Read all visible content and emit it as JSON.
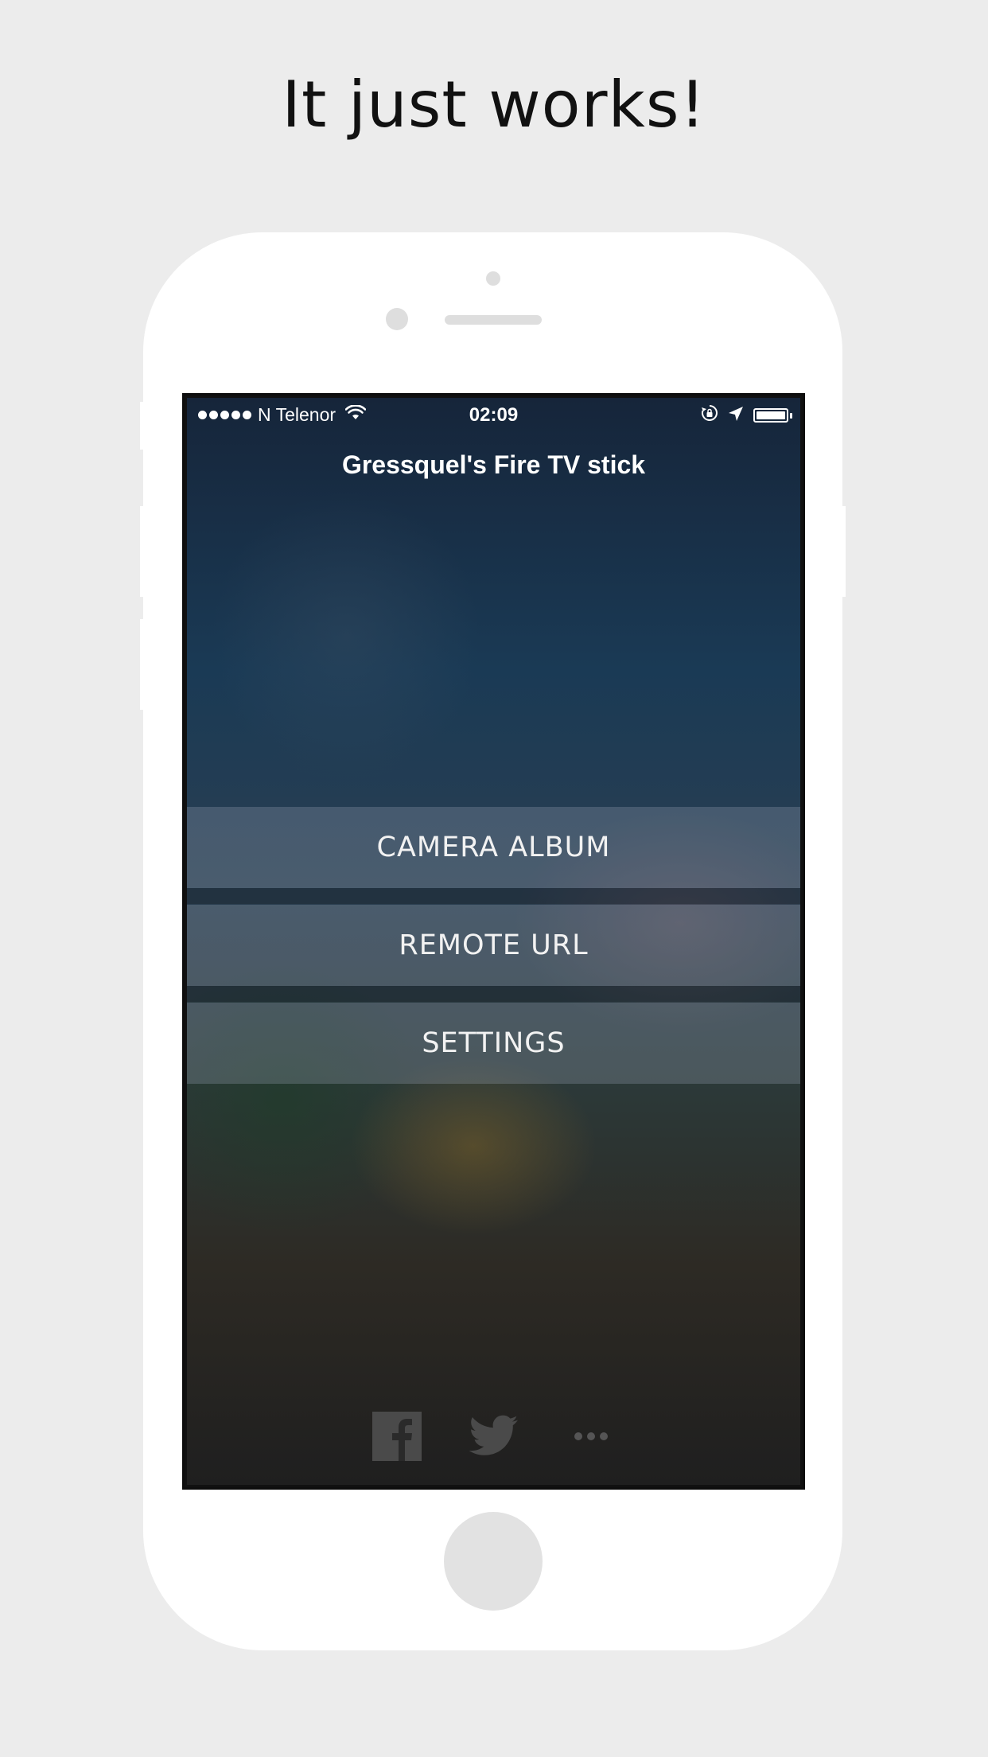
{
  "headline": "It just works!",
  "status_bar": {
    "carrier": "N Telenor",
    "time": "02:09",
    "signal_dots": 5,
    "battery_level": 1.0
  },
  "app": {
    "title": "Gressquel's Fire TV stick",
    "menu": [
      {
        "label": "CAMERA ALBUM"
      },
      {
        "label": "REMOTE URL"
      },
      {
        "label": "SETTINGS"
      }
    ],
    "social": [
      {
        "icon": "facebook-icon"
      },
      {
        "icon": "twitter-icon"
      },
      {
        "icon": "more-icon"
      }
    ]
  },
  "colors": {
    "page_background": "#ececec",
    "phone_body": "#ffffff",
    "icon_gray": "#4a4a4a"
  }
}
